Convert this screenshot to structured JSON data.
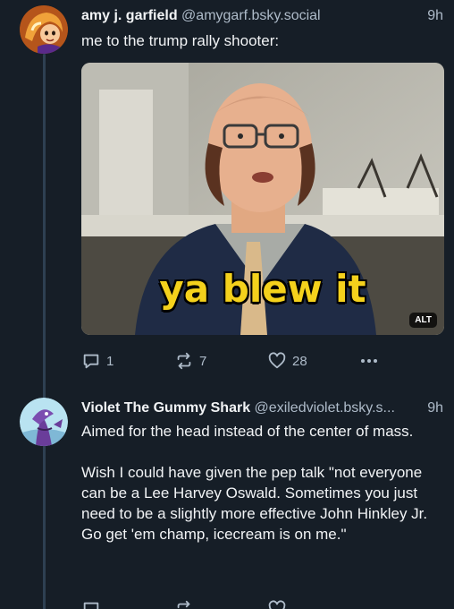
{
  "posts": [
    {
      "display_name": "amy j. garfield",
      "handle": "@amygarf.bsky.social",
      "time": "9h",
      "text": [
        "me to the trump rally shooter:"
      ],
      "media": {
        "caption": "ya blew it",
        "alt_badge": "ALT"
      },
      "actions": {
        "replies": "1",
        "reposts": "7",
        "likes": "28"
      }
    },
    {
      "display_name": "Violet The Gummy Shark",
      "handle": "@exiledviolet.bsky.s...",
      "time": "9h",
      "text": [
        "Aimed for the head instead of the center of mass.",
        "Wish I could have given the pep talk \"not everyone can be a Lee Harvey Oswald. Sometimes you just need to be a slightly more effective John Hinkley Jr. Go get 'em champ, icecream is on me.\""
      ]
    }
  ],
  "icons": {
    "reply": "reply-icon",
    "repost": "repost-icon",
    "like": "heart-icon",
    "more": "more-options-icon"
  },
  "colors": {
    "background": "#161e27",
    "muted_text": "#aebbc9",
    "thread_line": "#2e4052",
    "caption": "#f4d11c"
  }
}
